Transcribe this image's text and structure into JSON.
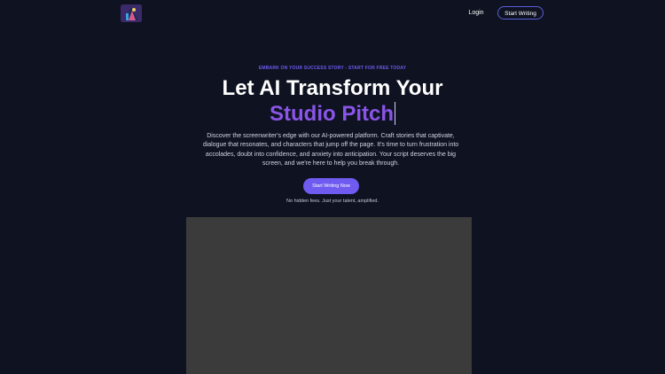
{
  "header": {
    "login_label": "Login",
    "start_label": "Start Writing"
  },
  "hero": {
    "eyebrow": "EMBARK ON YOUR SUCCESS STORY - START FOR FREE TODAY",
    "title_line1": "Let AI Transform Your",
    "title_line2": "Studio Pitch",
    "description": "Discover the screenwriter's edge with our AI-powered platform. Craft stories that captivate, dialogue that resonates, and characters that jump off the page. It's time to turn frustration into accolades, doubt into confidence, and anxiety into anticipation. Your script deserves the big screen, and we're here to help you break through.",
    "cta_label": "Start Writing Now",
    "note": "No hidden fees. Just your talent, amplified."
  },
  "colors": {
    "background": "#0e1221",
    "accent": "#6f5bf0",
    "title_accent": "#8a55e8",
    "media_placeholder": "#3b3b3b"
  },
  "icons": {
    "logo": "app-logo-icon"
  }
}
